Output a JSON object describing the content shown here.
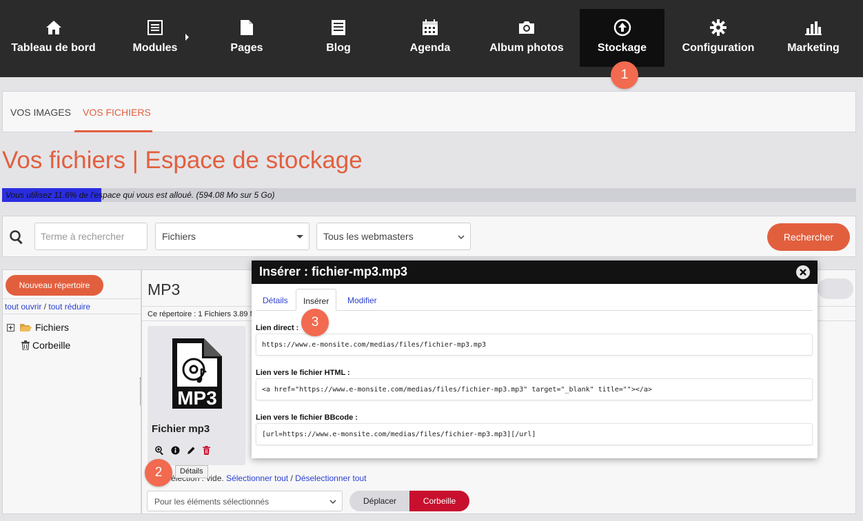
{
  "nav": {
    "items": [
      {
        "label": "Tableau de bord",
        "icon": "home-icon"
      },
      {
        "label": "Modules",
        "icon": "list-icon"
      },
      {
        "label": "Pages",
        "icon": "page-icon"
      },
      {
        "label": "Blog",
        "icon": "blog-icon"
      },
      {
        "label": "Agenda",
        "icon": "calendar-icon"
      },
      {
        "label": "Album photos",
        "icon": "camera-icon"
      },
      {
        "label": "Stockage",
        "icon": "upload-icon"
      },
      {
        "label": "Configuration",
        "icon": "gear-icon"
      },
      {
        "label": "Marketing",
        "icon": "bar-chart-icon"
      }
    ],
    "active": "Stockage"
  },
  "markers": [
    "1",
    "2",
    "3"
  ],
  "tabs": {
    "images": "VOS IMAGES",
    "files": "VOS FICHIERS",
    "active": "VOS FICHIERS"
  },
  "page_title": "Vos fichiers | Espace de stockage",
  "usage": {
    "text": "Vous utilisez 11.6% de l'espace qui vous est alloué. (594.08 Mo sur 5 Go)",
    "percent": 11.6
  },
  "search": {
    "placeholder": "Terme à rechercher",
    "type_value": "Fichiers",
    "webmaster_value": "Tous les webmasters",
    "button": "Rechercher"
  },
  "tree": {
    "new_dir_button": "Nouveau répertoire",
    "open_all": "tout ouvrir",
    "separator": "/",
    "collapse_all": "tout réduire",
    "items": [
      {
        "label": "Fichiers",
        "icon": "folder-icon"
      },
      {
        "label": "Corbeille",
        "icon": "trash-icon"
      }
    ]
  },
  "folder": {
    "title": "MP3",
    "info": "Ce répertoire : 1 Fichiers 3.89 Mo"
  },
  "file": {
    "name": "Fichier mp3",
    "icon_text": "MP3",
    "tooltip": "Détails"
  },
  "selection": {
    "prefix": "Sélection : vide.",
    "select_all": "Sélectionner tout",
    "separator": "/",
    "deselect_all": "Déselectionner tout",
    "bulk_placeholder": "Pour les éléments sélectionnés",
    "move_button": "Déplacer",
    "trash_button": "Corbeille"
  },
  "modal": {
    "title": "Insérer : fichier-mp3.mp3",
    "tabs": [
      "Détails",
      "Insérer",
      "Modifier"
    ],
    "active_tab": "Insérer",
    "direct_label": "Lien direct :",
    "direct_value": "https://www.e-monsite.com/medias/files/fichier-mp3.mp3",
    "html_label": "Lien vers le fichier HTML :",
    "html_value": "<a href=\"https://www.e-monsite.com/medias/files/fichier-mp3.mp3\" target=\"_blank\" title=\"\"></a>",
    "bbcode_label": "Lien vers le fichier BBcode :",
    "bbcode_value": "[url=https://www.e-monsite.com/medias/files/fichier-mp3.mp3][/url]"
  },
  "colors": {
    "accent": "#e25f3e",
    "nav_bg": "#2b2b2b",
    "usage_fill": "#2a2ee0",
    "trash": "#c8102e",
    "link": "#2a3fcf"
  }
}
